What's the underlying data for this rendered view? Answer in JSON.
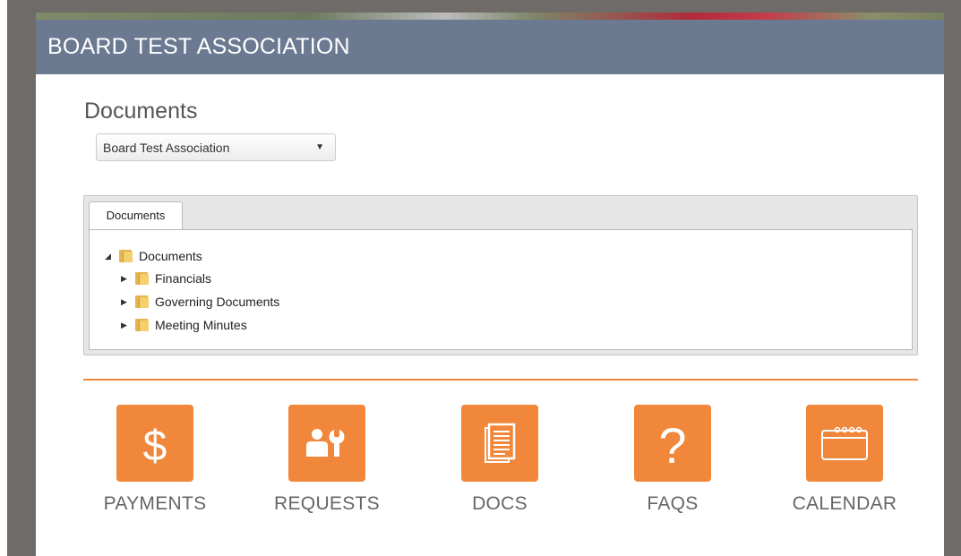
{
  "header": {
    "title": "BOARD TEST ASSOCIATION"
  },
  "page": {
    "title": "Documents"
  },
  "association_select": {
    "selected": "Board Test Association"
  },
  "tabs": [
    {
      "label": "Documents"
    }
  ],
  "tree": {
    "root": {
      "label": "Documents",
      "expanded": true
    },
    "children": [
      {
        "label": "Financials",
        "expanded": false
      },
      {
        "label": "Governing Documents",
        "expanded": false
      },
      {
        "label": "Meeting Minutes",
        "expanded": false
      }
    ]
  },
  "tiles": [
    {
      "label": "PAYMENTS",
      "icon": "dollar-icon"
    },
    {
      "label": "REQUESTS",
      "icon": "maintenance-request-icon"
    },
    {
      "label": "DOCS",
      "icon": "document-icon"
    },
    {
      "label": "FAQS",
      "icon": "question-icon"
    },
    {
      "label": "CALENDAR",
      "icon": "calendar-icon"
    }
  ],
  "colors": {
    "header_bg": "#6b7a91",
    "accent_orange": "#f0873a",
    "page_bg": "#6f6b68"
  }
}
